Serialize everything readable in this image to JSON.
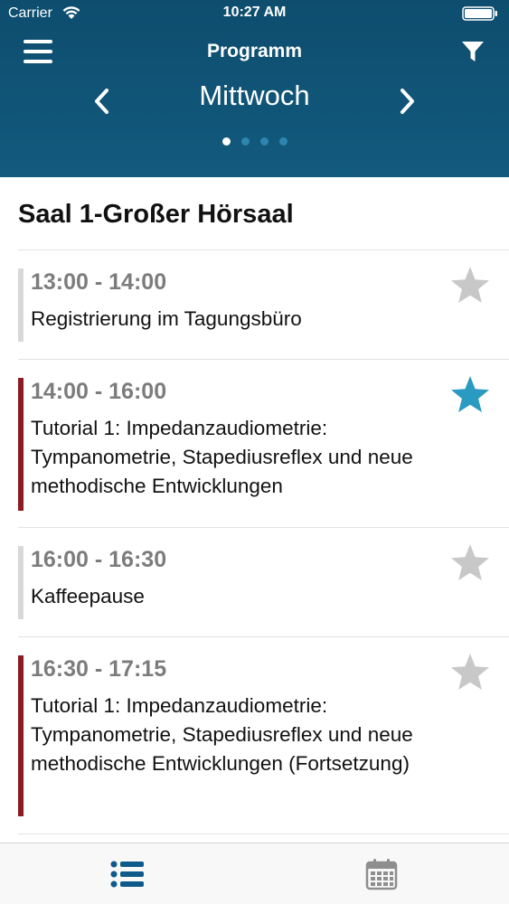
{
  "status_bar": {
    "carrier": "Carrier",
    "time": "10:27 AM"
  },
  "nav": {
    "title": "Programm",
    "menu_icon": "hamburger-menu-icon",
    "filter_icon": "filter-funnel-icon"
  },
  "day_selector": {
    "day": "Mittwoch",
    "prev_icon": "chevron-left-icon",
    "next_icon": "chevron-right-icon",
    "page_count": 4,
    "active_page": 1
  },
  "room": {
    "title": "Saal 1-Großer Hörsaal"
  },
  "sessions": [
    {
      "time": "13:00 - 14:00",
      "title": "Registrierung im Tagungsbüro",
      "category_color": "#d8d8d8",
      "favorite": false
    },
    {
      "time": "14:00 - 16:00",
      "title": "Tutorial 1: Impedanzaudiometrie: Tympanometrie, Stapediusreflex und neue methodische Entwicklungen",
      "category_color": "#8c1c24",
      "favorite": true
    },
    {
      "time": "16:00 - 16:30",
      "title": "Kaffeepause",
      "category_color": "#d8d8d8",
      "favorite": false
    },
    {
      "time": "16:30 - 17:15",
      "title": "Tutorial 1: Impedanzaudiometrie: Tympanometrie, Stapediusreflex und neue methodische Entwicklungen (Fortsetzung)",
      "category_color": "#8c1c24",
      "favorite": false
    }
  ],
  "tab_bar": {
    "tabs": [
      {
        "icon": "list-icon",
        "active": true
      },
      {
        "icon": "calendar-icon",
        "active": false
      }
    ]
  },
  "colors": {
    "header": "#0e4d6e",
    "star_active": "#2a9ac0",
    "star_inactive": "#c8c8c8",
    "tab_active": "#0e5a8a",
    "tab_inactive": "#8e8e8e"
  }
}
